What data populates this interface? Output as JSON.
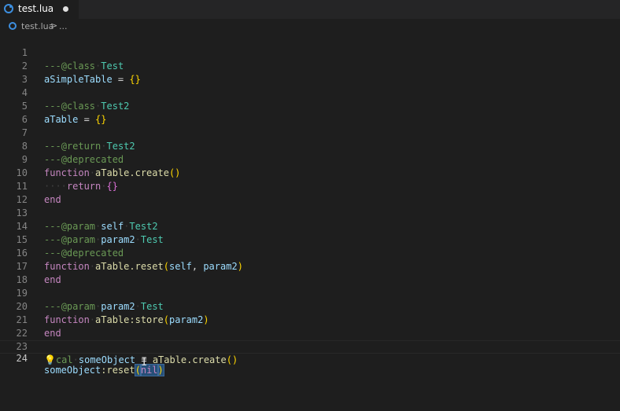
{
  "tab": {
    "label": "test.lua",
    "icon": "lua-file-icon",
    "dirty": true
  },
  "breadcrumb": {
    "file": "test.lua",
    "separator": ">",
    "more": "..."
  },
  "line_numbers": [
    "1",
    "2",
    "3",
    "4",
    "5",
    "6",
    "7",
    "8",
    "9",
    "10",
    "11",
    "12",
    "13",
    "14",
    "15",
    "16",
    "17",
    "18",
    "19",
    "20",
    "21",
    "22",
    "23",
    "24"
  ],
  "code": {
    "l1_dash": "---",
    "l1_tag": "@class",
    "l1_type": "Test",
    "l2_name": "aSimpleTable",
    "l2_eq": " = ",
    "l2_val": "{}",
    "l4_dash": "---",
    "l4_tag": "@class",
    "l4_type": "Test2",
    "l5_name": "aTable",
    "l5_eq": " = ",
    "l5_val": "{}",
    "l7_dash": "---",
    "l7_tag": "@return",
    "l7_type": "Test2",
    "l8_dash": "---",
    "l8_tag": "@deprecated",
    "l9_kw": "function",
    "l9_name": "aTable.create",
    "l9_parens": "()",
    "l10_kw": "return",
    "l10_val": "{}",
    "l11_kw": "end",
    "l13_dash": "---",
    "l13_tag": "@param",
    "l13_param": "self",
    "l13_type": "Test2",
    "l14_dash": "---",
    "l14_tag": "@param",
    "l14_param": "param2",
    "l14_type": "Test",
    "l15_dash": "---",
    "l15_tag": "@deprecated",
    "l16_kw": "function",
    "l16_name": "aTable.reset",
    "l16_open": "(",
    "l16_p1": "self",
    "l16_comma": ", ",
    "l16_p2": "param2",
    "l16_close": ")",
    "l17_kw": "end",
    "l19_dash": "---",
    "l19_tag": "@param",
    "l19_param": "param2",
    "l19_type": "Test",
    "l20_kw": "function",
    "l20_name": "aTable:store",
    "l20_open": "(",
    "l20_p1": "param2",
    "l20_close": ")",
    "l21_kw": "end",
    "l23_hint": "cal",
    "l23_name": "someObject",
    "l23_eq": " = ",
    "l23_call": "aTable.create",
    "l23_parens": "()",
    "l24_obj": "someObject",
    "l24_method": ":reset",
    "l24_open": "(",
    "l24_arg": "nil",
    "l24_close": ")"
  },
  "colors": {
    "background": "#1e1e1e",
    "comment": "#6a9955",
    "keyword": "#c586c0",
    "type": "#4ec9b0",
    "function": "#dcdcaa",
    "variable": "#9cdcfe",
    "bracket": "#ffd700"
  }
}
